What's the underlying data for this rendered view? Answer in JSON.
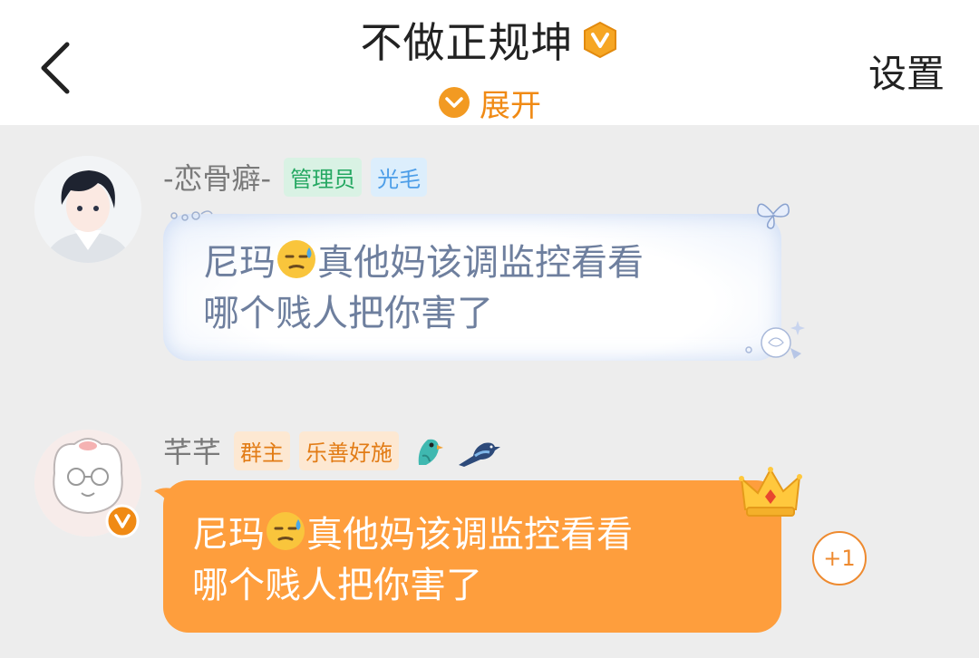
{
  "header": {
    "title": "不做正规坤",
    "expand_label": "展开",
    "settings_label": "设置"
  },
  "messages": [
    {
      "username": "-恋骨癖-",
      "badges": [
        "管理员",
        "光毛"
      ],
      "text_line1": "尼玛",
      "text_line1b": "真他妈该调监控看看",
      "text_line2": "哪个贱人把你害了"
    },
    {
      "username": "芊芊",
      "badges": [
        "群主",
        "乐善好施"
      ],
      "text_line1": "尼玛",
      "text_line1b": "真他妈该调监控看看",
      "text_line2": "哪个贱人把你害了",
      "reaction": "+1"
    }
  ],
  "colors": {
    "accent": "#f08a14",
    "bubble_orange": "#fe9e3d",
    "admin_green": "#25a862"
  }
}
